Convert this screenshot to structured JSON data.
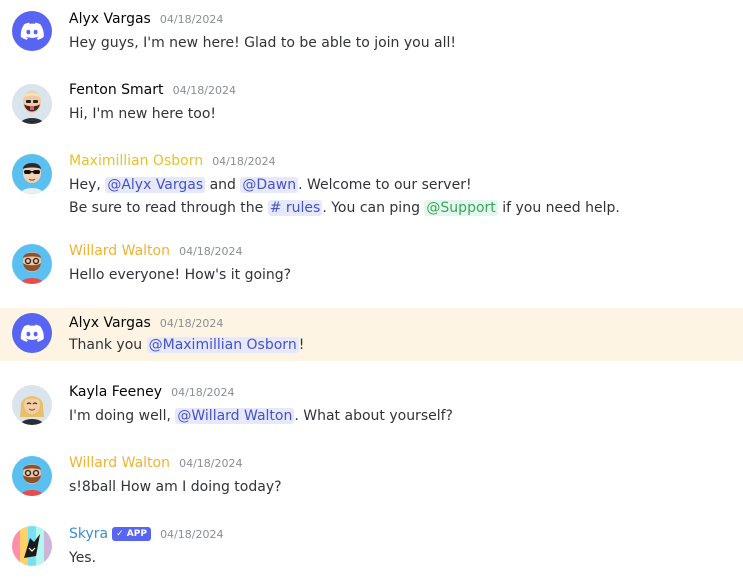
{
  "colors": {
    "blurple": "#5865f2",
    "highlight": "#fdf4e3",
    "gold_name": "#f0b232",
    "yellow_name": "#e6c12a",
    "blue_name": "#3a8fd4",
    "mention_bg": "#e6e8fd",
    "mention_fg": "#4752c4",
    "role_fg": "#3ba55c"
  },
  "messages": [
    {
      "author": "Alyx Vargas",
      "timestamp": "04/18/2024",
      "avatar": "discord-logo-icon",
      "line1": "Hey guys, I'm new here! Glad to be able to join you all!"
    },
    {
      "author": "Fenton Smart",
      "timestamp": "04/18/2024",
      "avatar": "bearded-man-avatar",
      "line1": "Hi, I'm new here too!"
    },
    {
      "author": "Maximillian Osborn",
      "timestamp": "04/18/2024",
      "avatar": "sunglasses-man-avatar",
      "line1_prefix": "Hey, ",
      "mention1": "@Alyx Vargas",
      "line1_and": " and ",
      "mention2": "@Dawn",
      "line1_suffix": ". Welcome to our server!",
      "line2_prefix": "Be sure to read through the ",
      "channel_hash": "#",
      "channel": " rules",
      "line2_mid": ". You can ping ",
      "role_mention": "@Support",
      "line2_suffix": " if you need help."
    },
    {
      "author": "Willard Walton",
      "timestamp": "04/18/2024",
      "avatar": "bearded-glasses-man-avatar",
      "line1": "Hello everyone! How's it going?"
    },
    {
      "author": "Alyx Vargas",
      "timestamp": "04/18/2024",
      "avatar": "discord-logo-icon",
      "line1_prefix": "Thank you ",
      "mention1": "@Maximillian Osborn",
      "line1_suffix": "!"
    },
    {
      "author": "Kayla Feeney",
      "timestamp": "04/18/2024",
      "avatar": "blonde-woman-avatar",
      "line1_prefix": "I'm doing well, ",
      "mention1": "@Willard Walton",
      "line1_suffix": ". What about yourself?"
    },
    {
      "author": "Willard Walton",
      "timestamp": "04/18/2024",
      "avatar": "bearded-glasses-man-avatar",
      "line1": "s!8ball How am I doing today?"
    },
    {
      "author": "Skyra",
      "badge": "✓ APP",
      "timestamp": "04/18/2024",
      "avatar": "skyra-bot-avatar",
      "line1": "Yes."
    }
  ]
}
